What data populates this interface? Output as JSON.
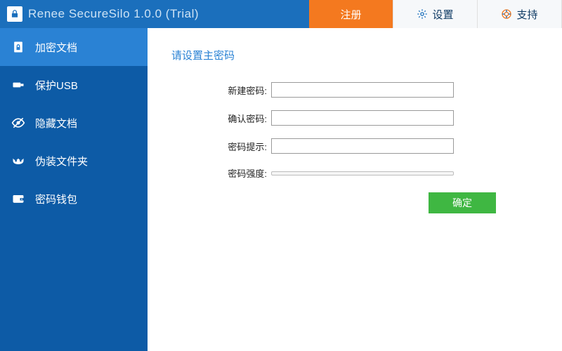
{
  "app": {
    "title": "Renee SecureSilo 1.0.0 (Trial)"
  },
  "tabs": {
    "register": "注册",
    "settings": "设置",
    "support": "支持"
  },
  "sidebar": {
    "items": [
      {
        "label": "加密文档"
      },
      {
        "label": "保护USB"
      },
      {
        "label": "隐藏文档"
      },
      {
        "label": "伪装文件夹"
      },
      {
        "label": "密码钱包"
      }
    ]
  },
  "form": {
    "title": "请设置主密码",
    "new_password_label": "新建密码:",
    "confirm_password_label": "确认密码:",
    "hint_label": "密码提示:",
    "strength_label": "密码强度:",
    "submit": "确定"
  },
  "colors": {
    "primary": "#0d5ba6",
    "primary_light": "#2a82d4",
    "accent": "#f4791f",
    "success": "#3fb742"
  }
}
